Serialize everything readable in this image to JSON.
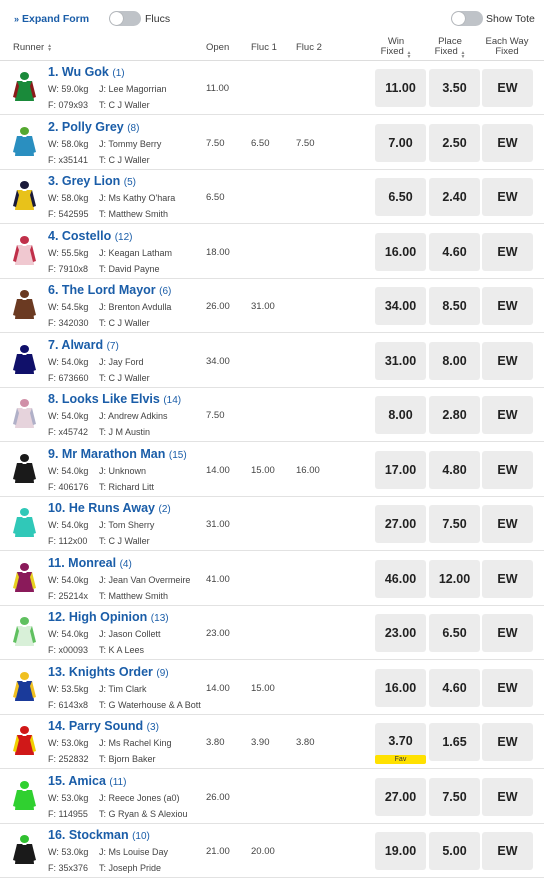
{
  "topbar": {
    "expand_label": "Expand Form",
    "flucs_label": "Flucs",
    "tote_label": "Show Tote"
  },
  "header": {
    "runner": "Runner",
    "open": "Open",
    "fluc1": "Fluc 1",
    "fluc2": "Fluc 2",
    "win": [
      "Win",
      "Fixed"
    ],
    "place": [
      "Place",
      "Fixed"
    ],
    "ew": [
      "Each Way",
      "Fixed"
    ]
  },
  "runners": [
    {
      "name": "1. Wu Gok",
      "barrier": "(1)",
      "weight": "W: 59.0kg",
      "jockey": "J: Lee Magorrian",
      "form": "F: 079x93",
      "trainer": "T: C J Waller",
      "open": "11.00",
      "fluc1": "",
      "fluc2": "",
      "win": "11.00",
      "place": "3.50",
      "ew": "EW",
      "silk": {
        "body": "#1a8a3a",
        "sleeve": "#8b1a1a",
        "cap": "#1a8a3a"
      }
    },
    {
      "name": "2. Polly Grey",
      "barrier": "(8)",
      "weight": "W: 58.0kg",
      "jockey": "J: Tommy Berry",
      "form": "F: x35141",
      "trainer": "T: C J Waller",
      "open": "7.50",
      "fluc1": "6.50",
      "fluc2": "7.50",
      "win": "7.00",
      "place": "2.50",
      "ew": "EW",
      "silk": {
        "body": "#2a8fc0",
        "sleeve": "#2a8fc0",
        "cap": "#55a830"
      }
    },
    {
      "name": "3. Grey Lion",
      "barrier": "(5)",
      "weight": "W: 58.0kg",
      "jockey": "J: Ms Kathy O'hara",
      "form": "F: 542595",
      "trainer": "T: Matthew Smith",
      "open": "6.50",
      "fluc1": "",
      "fluc2": "",
      "win": "6.50",
      "place": "2.40",
      "ew": "EW",
      "silk": {
        "body": "#e8c21a",
        "sleeve": "#1a1a3a",
        "cap": "#1a1a3a"
      }
    },
    {
      "name": "4. Costello",
      "barrier": "(12)",
      "weight": "W: 55.5kg",
      "jockey": "J: Keagan Latham",
      "form": "F: 7910x8",
      "trainer": "T: David Payne",
      "open": "18.00",
      "fluc1": "",
      "fluc2": "",
      "win": "16.00",
      "place": "4.60",
      "ew": "EW",
      "silk": {
        "body": "#f0c8d0",
        "sleeve": "#c0304a",
        "cap": "#c0304a"
      }
    },
    {
      "name": "6. The Lord Mayor",
      "barrier": "(6)",
      "weight": "W: 54.5kg",
      "jockey": "J: Brenton Avdulla",
      "form": "F: 342030",
      "trainer": "T: C J Waller",
      "open": "26.00",
      "fluc1": "31.00",
      "fluc2": "",
      "win": "34.00",
      "place": "8.50",
      "ew": "EW",
      "silk": {
        "body": "#6b3a22",
        "sleeve": "#6b3a22",
        "cap": "#6b3a22"
      }
    },
    {
      "name": "7. Alward",
      "barrier": "(7)",
      "weight": "W: 54.0kg",
      "jockey": "J: Jay Ford",
      "form": "F: 673660",
      "trainer": "T: C J Waller",
      "open": "34.00",
      "fluc1": "",
      "fluc2": "",
      "win": "31.00",
      "place": "8.00",
      "ew": "EW",
      "silk": {
        "body": "#10106a",
        "sleeve": "#10106a",
        "cap": "#10106a"
      }
    },
    {
      "name": "8. Looks Like Elvis",
      "barrier": "(14)",
      "weight": "W: 54.0kg",
      "jockey": "J: Andrew Adkins",
      "form": "F: x45742",
      "trainer": "T: J M Austin",
      "open": "7.50",
      "fluc1": "",
      "fluc2": "",
      "win": "8.00",
      "place": "2.80",
      "ew": "EW",
      "silk": {
        "body": "#e6d3dc",
        "sleeve": "#b0b0c8",
        "cap": "#d090a8"
      }
    },
    {
      "name": "9. Mr Marathon Man",
      "barrier": "(15)",
      "weight": "W: 54.0kg",
      "jockey": "J: Unknown",
      "form": "F: 406176",
      "trainer": "T: Richard Litt",
      "open": "14.00",
      "fluc1": "15.00",
      "fluc2": "16.00",
      "win": "17.00",
      "place": "4.80",
      "ew": "EW",
      "silk": {
        "body": "#1a1a1a",
        "sleeve": "#1a1a1a",
        "cap": "#1a1a1a"
      }
    },
    {
      "name": "10. He Runs Away",
      "barrier": "(2)",
      "weight": "W: 54.0kg",
      "jockey": "J: Tom Sherry",
      "form": "F: 112x00",
      "trainer": "T: C J Waller",
      "open": "31.00",
      "fluc1": "",
      "fluc2": "",
      "win": "27.00",
      "place": "7.50",
      "ew": "EW",
      "silk": {
        "body": "#30c8b8",
        "sleeve": "#30c8b8",
        "cap": "#30c8b8"
      }
    },
    {
      "name": "11. Monreal",
      "barrier": "(4)",
      "weight": "W: 54.0kg",
      "jockey": "J: Jean Van Overmeire",
      "form": "F: 25214x",
      "trainer": "T: Matthew Smith",
      "open": "41.00",
      "fluc1": "",
      "fluc2": "",
      "win": "46.00",
      "place": "12.00",
      "ew": "EW",
      "silk": {
        "body": "#8a1a5a",
        "sleeve": "#e8d020",
        "cap": "#8a1a5a"
      }
    },
    {
      "name": "12. High Opinion",
      "barrier": "(13)",
      "weight": "W: 54.0kg",
      "jockey": "J: Jason Collett",
      "form": "F: x00093",
      "trainer": "T: K A Lees",
      "open": "23.00",
      "fluc1": "",
      "fluc2": "",
      "win": "23.00",
      "place": "6.50",
      "ew": "EW",
      "silk": {
        "body": "#d8f0d8",
        "sleeve": "#60c060",
        "cap": "#60c060"
      }
    },
    {
      "name": "13. Knights Order",
      "barrier": "(9)",
      "weight": "W: 53.5kg",
      "jockey": "J: Tim Clark",
      "form": "F: 6143x8",
      "trainer": "T: G Waterhouse & A Bott",
      "open": "14.00",
      "fluc1": "15.00",
      "fluc2": "",
      "win": "16.00",
      "place": "4.60",
      "ew": "EW",
      "silk": {
        "body": "#1a3a9a",
        "sleeve": "#f0c020",
        "cap": "#f0c020"
      }
    },
    {
      "name": "14. Parry Sound",
      "barrier": "(3)",
      "weight": "W: 53.0kg",
      "jockey": "J: Ms Rachel King",
      "form": "F: 252832",
      "trainer": "T: Bjorn Baker",
      "open": "3.80",
      "fluc1": "3.90",
      "fluc2": "3.80",
      "win": "3.70",
      "place": "1.65",
      "ew": "EW",
      "fav": "Fav",
      "silk": {
        "body": "#d01818",
        "sleeve": "#f0d000",
        "cap": "#d01818"
      }
    },
    {
      "name": "15. Amica",
      "barrier": "(11)",
      "weight": "W: 53.0kg",
      "jockey": "J: Reece Jones (a0)",
      "form": "F: 114955",
      "trainer": "T: G Ryan & S Alexiou",
      "open": "26.00",
      "fluc1": "",
      "fluc2": "",
      "win": "27.00",
      "place": "7.50",
      "ew": "EW",
      "silk": {
        "body": "#30d030",
        "sleeve": "#30d030",
        "cap": "#30d030"
      }
    },
    {
      "name": "16. Stockman",
      "barrier": "(10)",
      "weight": "W: 53.0kg",
      "jockey": "J: Ms Louise Day",
      "form": "F: 35x376",
      "trainer": "T: Joseph Pride",
      "open": "21.00",
      "fluc1": "20.00",
      "fluc2": "",
      "win": "19.00",
      "place": "5.00",
      "ew": "EW",
      "silk": {
        "body": "#1a1a1a",
        "sleeve": "#1a1a1a",
        "cap": "#30c030"
      }
    }
  ]
}
